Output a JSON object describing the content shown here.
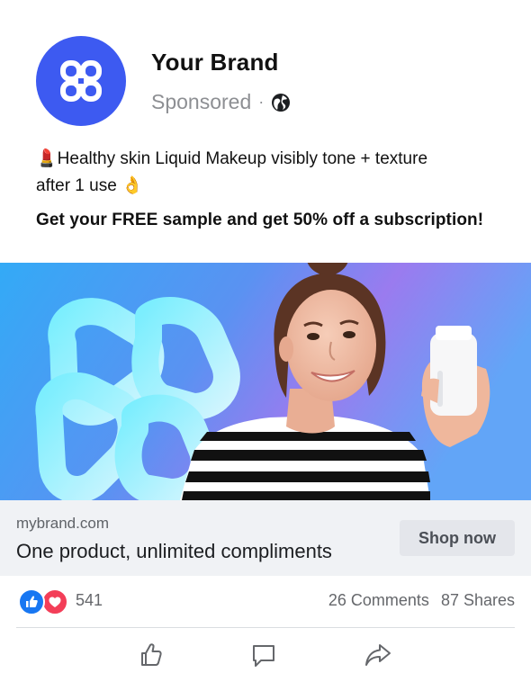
{
  "post": {
    "brand_name": "Your Brand",
    "sponsored_label": "Sponsored",
    "separator": "·",
    "body_line1": "💄Healthy skin Liquid Makeup visibly tone + texture",
    "body_line2": "after 1 use 👌",
    "cta_text": "Get your FREE sample and get 50% off a subscription!"
  },
  "link": {
    "domain": "mybrand.com",
    "headline": "One product, unlimited compliments",
    "button_label": "Shop now"
  },
  "engagement": {
    "reaction_count": "541",
    "comments": "26 Comments",
    "shares": "87 Shares"
  },
  "colors": {
    "brand_accent": "#3d5af1",
    "like_blue": "#1877f2",
    "love_red": "#f33e58",
    "link_bar_bg": "#f0f2f5"
  },
  "icons": {
    "avatar": "brand-logo-icon",
    "audience": "globe-icon",
    "like_reaction": "thumbs-up-icon",
    "love_reaction": "heart-icon",
    "like_action": "like-icon",
    "comment_action": "comment-icon",
    "share_action": "share-icon"
  }
}
